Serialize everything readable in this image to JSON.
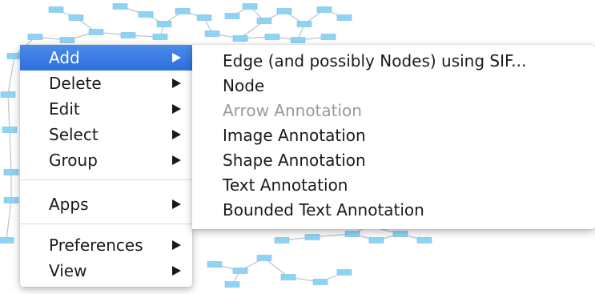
{
  "main_menu": {
    "items": [
      {
        "label": "Add",
        "active": true
      },
      {
        "label": "Delete"
      },
      {
        "label": "Edit"
      },
      {
        "label": "Select"
      },
      {
        "label": "Group"
      },
      {
        "label": "Apps"
      },
      {
        "label": "Preferences"
      },
      {
        "label": "View"
      }
    ]
  },
  "submenu": {
    "items": [
      {
        "label": "Edge (and possibly Nodes) using SIF...",
        "enabled": true
      },
      {
        "label": "Node",
        "enabled": true
      },
      {
        "label": "Arrow Annotation",
        "enabled": false
      },
      {
        "label": "Image Annotation",
        "enabled": true
      },
      {
        "label": "Shape Annotation",
        "enabled": true
      },
      {
        "label": "Text Annotation",
        "enabled": true
      },
      {
        "label": "Bounded Text Annotation",
        "enabled": true
      }
    ]
  },
  "colors": {
    "highlight": "#3a7de3",
    "disabled_text": "#9a9a9a",
    "node_fill": "#8fd3f4",
    "edge": "#b8c4cc"
  },
  "background": {
    "description_icon": "network-graph",
    "node_label": "node"
  }
}
